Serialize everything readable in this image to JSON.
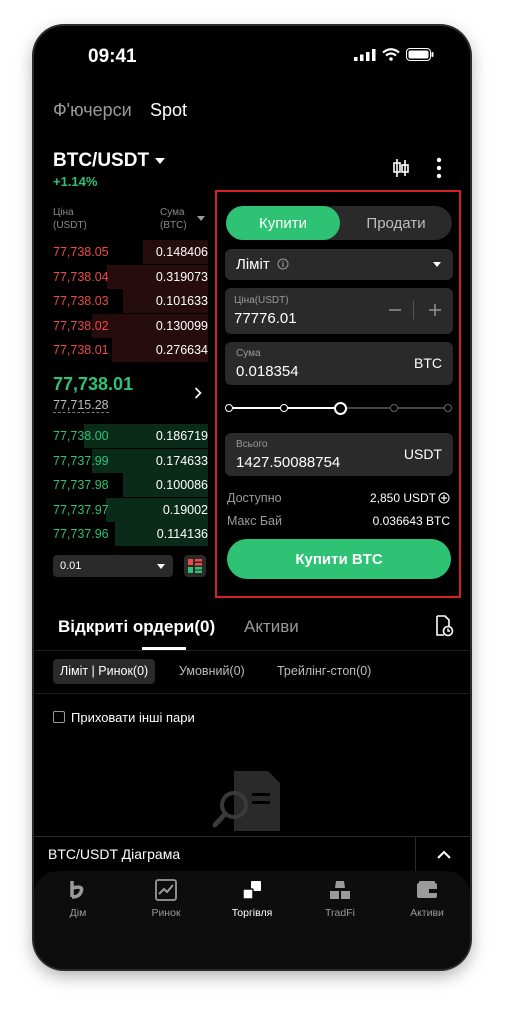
{
  "status": {
    "time": "09:41"
  },
  "top_tabs": [
    "Ф'ючерси",
    "Spot"
  ],
  "pair": {
    "name": "BTC/USDT",
    "change": "+1.14%"
  },
  "orderbook": {
    "price_header": "Ціна\n(USDT)",
    "amount_header": "Сума\n(BTC)",
    "asks": [
      {
        "price": "77,738.05",
        "amount": "0.148406",
        "depth": 0.42
      },
      {
        "price": "77,738.04",
        "amount": "0.319073",
        "depth": 0.65
      },
      {
        "price": "77,738.03",
        "amount": "0.101633",
        "depth": 0.55
      },
      {
        "price": "77,738.02",
        "amount": "0.130099",
        "depth": 0.75
      },
      {
        "price": "77,738.01",
        "amount": "0.276634",
        "depth": 0.62
      }
    ],
    "last_price": "77,738.01",
    "mark_price": "77,715.28",
    "bids": [
      {
        "price": "77,738.00",
        "amount": "0.186719",
        "depth": 0.8
      },
      {
        "price": "77,737.99",
        "amount": "0.174633",
        "depth": 0.75
      },
      {
        "price": "77,737.98",
        "amount": "0.100086",
        "depth": 0.55
      },
      {
        "price": "77,737.97",
        "amount": "0.19002",
        "depth": 0.66
      },
      {
        "price": "77,737.96",
        "amount": "0.114136",
        "depth": 0.6
      }
    ],
    "precision": "0.01"
  },
  "order_form": {
    "buy_label": "Купити",
    "sell_label": "Продати",
    "order_type": "Ліміт",
    "price_label": "Ціна(USDT)",
    "price_value": "77776.01",
    "amount_label": "Сума",
    "amount_value": "0.018354",
    "amount_unit": "BTC",
    "slider_percent": 50,
    "total_label": "Всього",
    "total_value": "1427.50088754",
    "total_unit": "USDT",
    "available_label": "Доступно",
    "available_value": "2,850 USDT",
    "max_buy_label": "Макс Бай",
    "max_buy_value": "0.036643 BTC",
    "submit_label": "Купити BTC"
  },
  "orders": {
    "tab_open": "Відкриті ордери(0)",
    "tab_assets": "Активи",
    "filters": [
      "Ліміт | Ринок(0)",
      "Умовний(0)",
      "Трейлінг-стоп(0)"
    ],
    "hide_pairs": "Приховати інші пари"
  },
  "chart_bar": {
    "label": "BTC/USDT Діаграма"
  },
  "nav": [
    {
      "label": "Дім",
      "icon": "home-icon"
    },
    {
      "label": "Ринок",
      "icon": "market-icon"
    },
    {
      "label": "Торгівля",
      "icon": "trade-icon"
    },
    {
      "label": "TradFi",
      "icon": "tradfi-icon"
    },
    {
      "label": "Активи",
      "icon": "wallet-icon"
    }
  ],
  "colors": {
    "green": "#2ec274",
    "red": "#ee4a4a",
    "highlight": "#d62025"
  }
}
